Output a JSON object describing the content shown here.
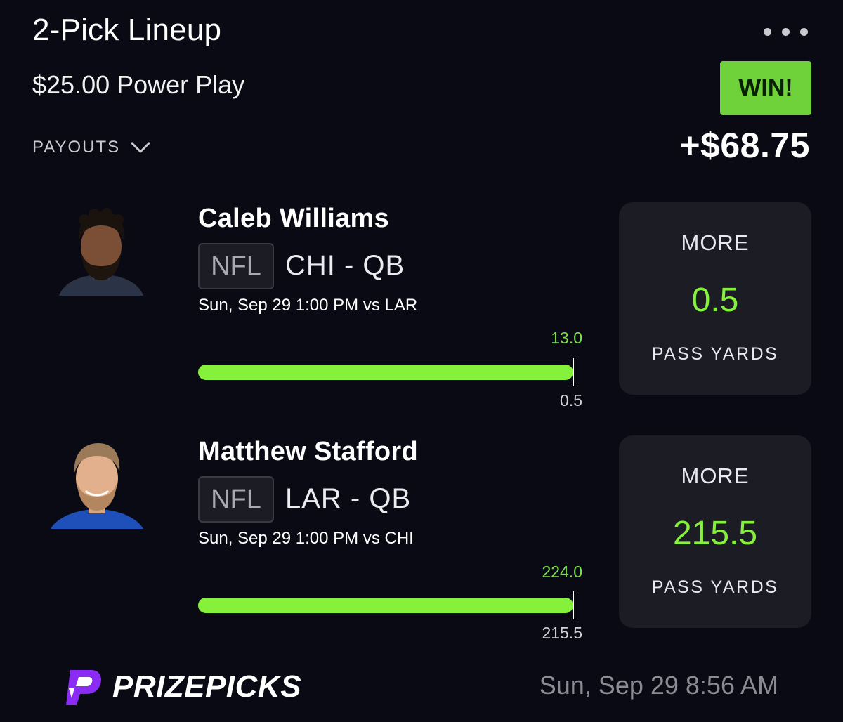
{
  "header": {
    "title": "2-Pick Lineup",
    "entry": "$25.00 Power Play",
    "payouts_label": "PAYOUTS",
    "result_badge": "WIN!",
    "winnings": "+$68.75"
  },
  "picks": [
    {
      "player": "Caleb Williams",
      "league": "NFL",
      "team_position": "CHI - QB",
      "game_time": "Sun, Sep 29 1:00 PM  vs LAR",
      "actual": "13.0",
      "line": "0.5",
      "progress": 1.0,
      "direction": "MORE",
      "projection": "0.5",
      "stat": "PASS YARDS"
    },
    {
      "player": "Matthew Stafford",
      "league": "NFL",
      "team_position": "LAR - QB",
      "game_time": "Sun, Sep 29 1:00 PM  vs CHI",
      "actual": "224.0",
      "line": "215.5",
      "progress": 1.0,
      "direction": "MORE",
      "projection": "215.5",
      "stat": "PASS YARDS"
    }
  ],
  "footer": {
    "brand": "PRIZEPICKS",
    "timestamp": "Sun, Sep 29 8:56 AM"
  },
  "colors": {
    "background": "#0a0a14",
    "accent_green": "#86f13a",
    "win_badge": "#6fd23a",
    "card": "#1c1c24",
    "brand_purple": "#8b2cf5"
  },
  "icons": {
    "menu": "more-dots-icon",
    "payouts_toggle": "chevron-down-icon",
    "logo": "prizepicks-logo-icon"
  }
}
